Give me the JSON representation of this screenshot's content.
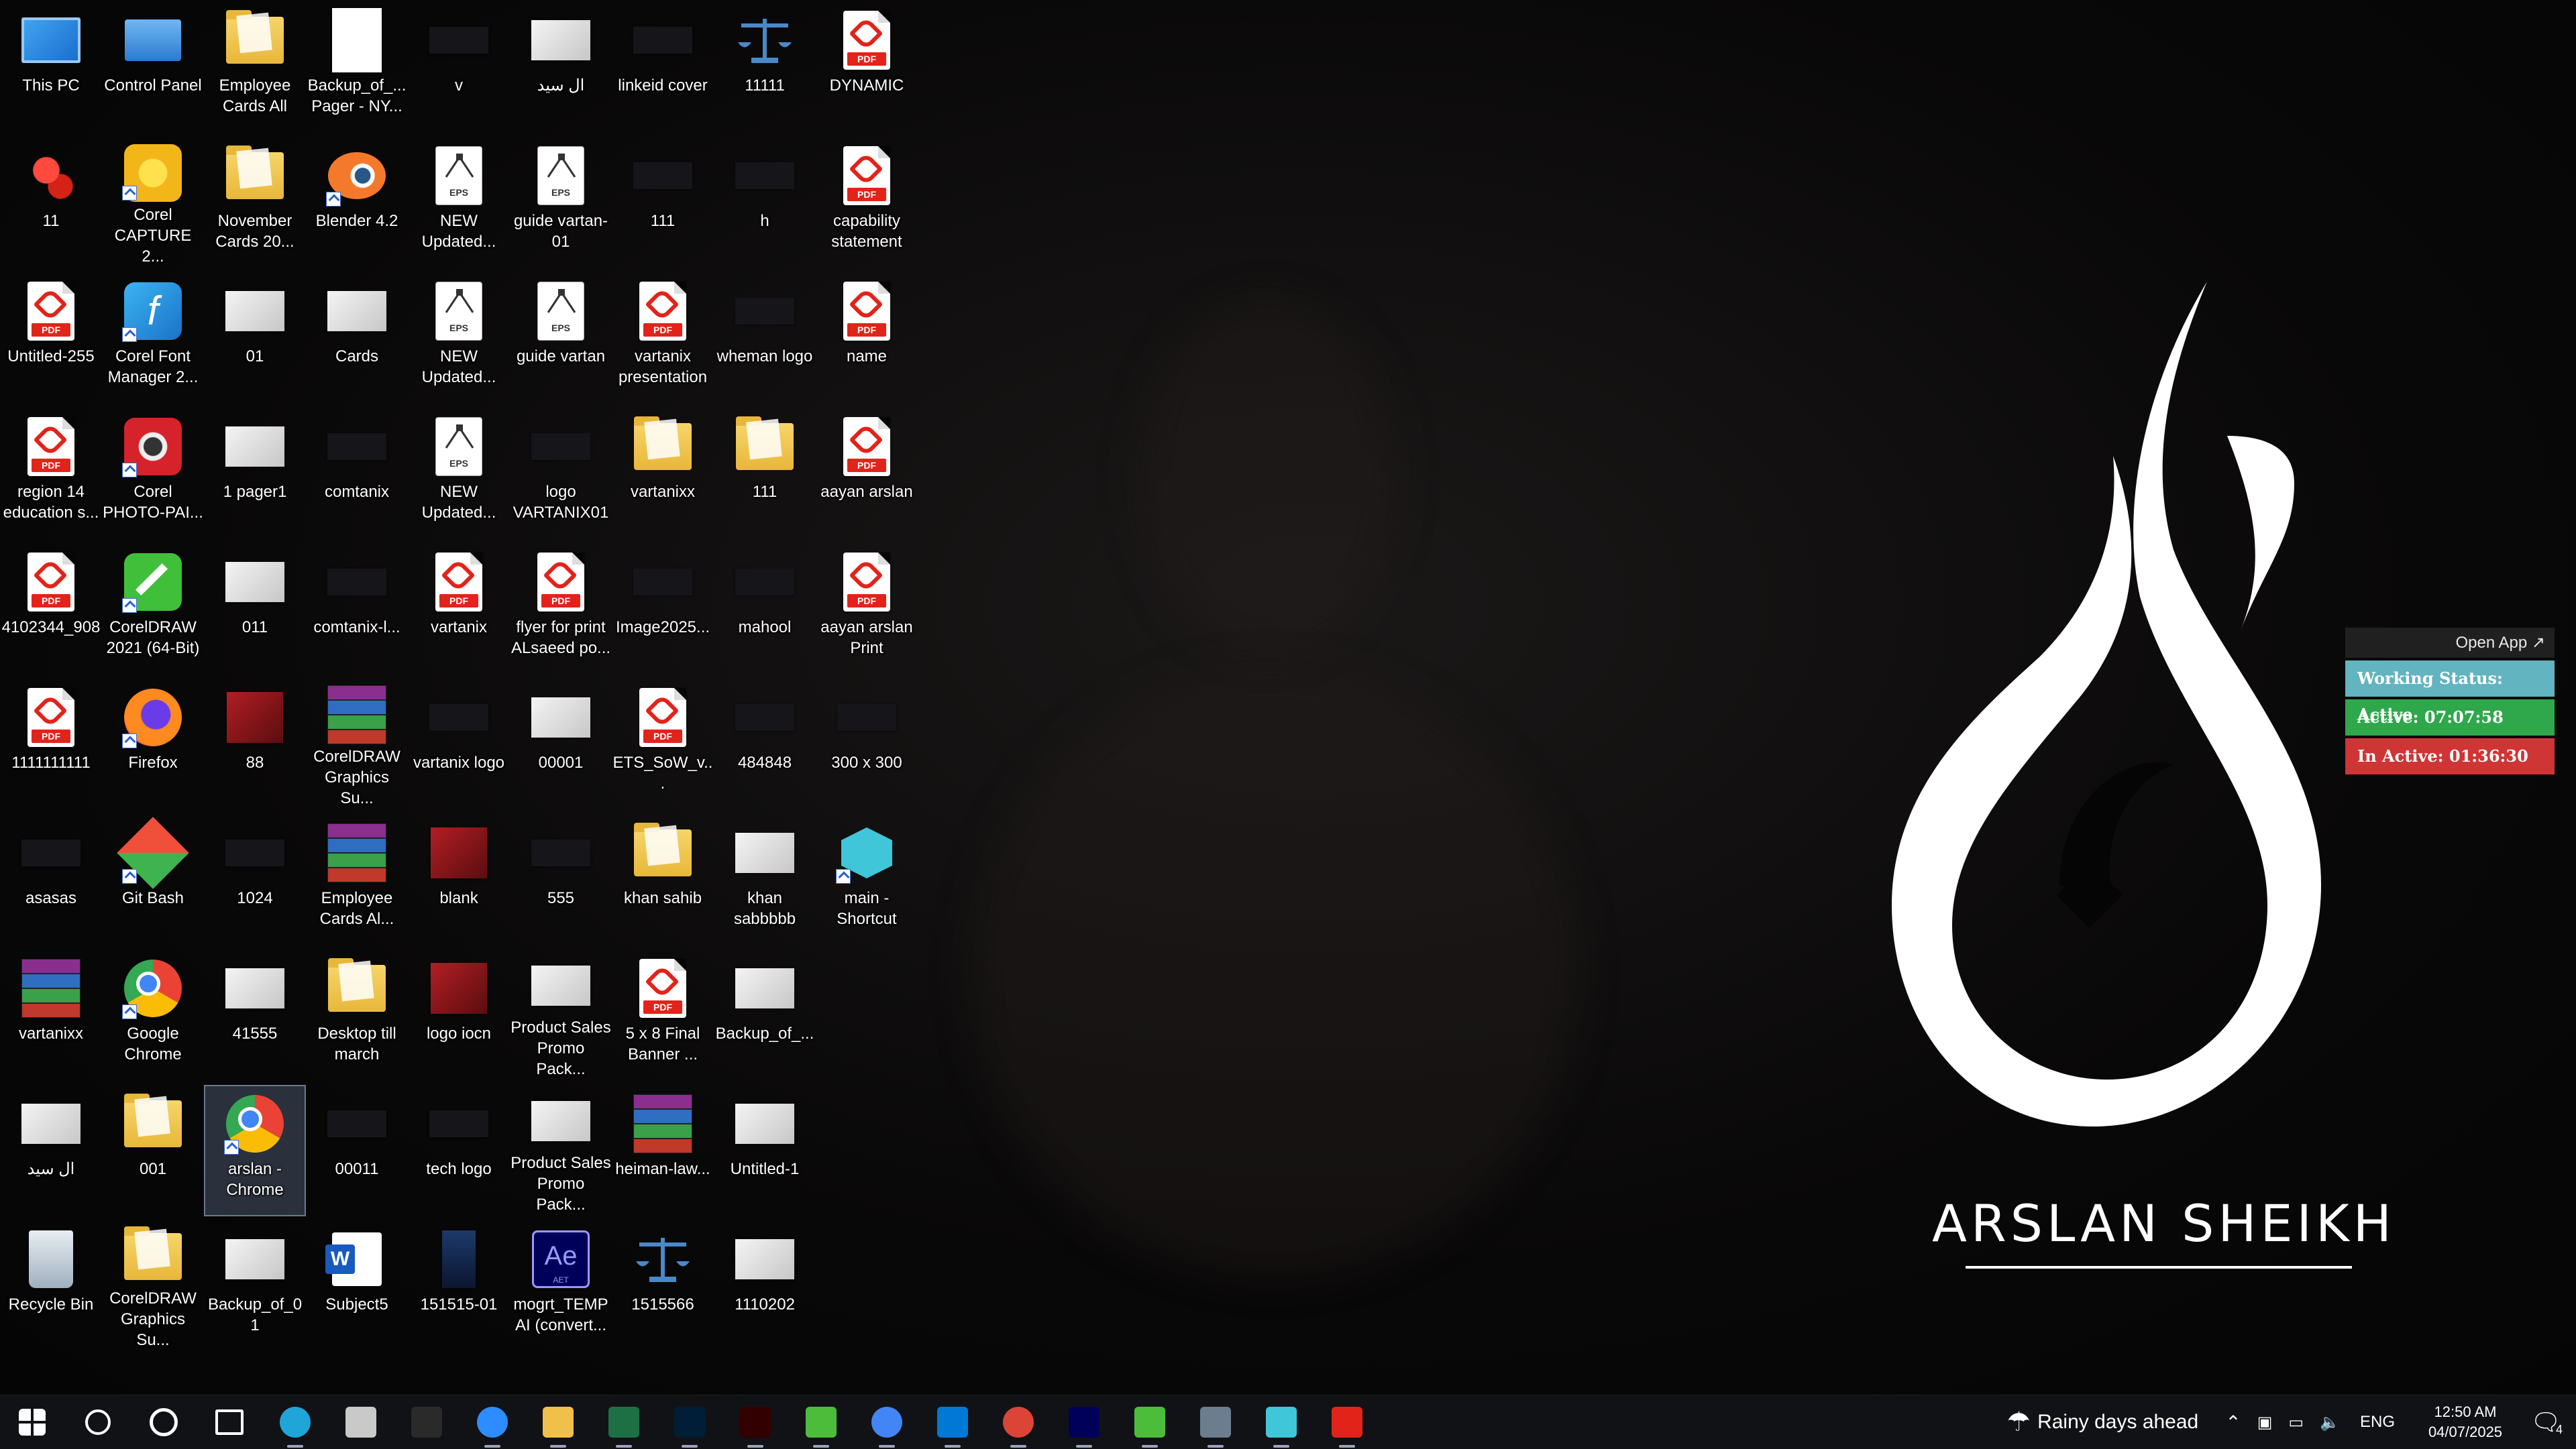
{
  "desktop": {
    "icons": [
      {
        "label": "This PC",
        "type": "pc"
      },
      {
        "label": "Control Panel",
        "type": "cpanel"
      },
      {
        "label": "Employee Cards All",
        "type": "folder"
      },
      {
        "label": "Backup_of_... Pager - NY...",
        "type": "doc"
      },
      {
        "label": "v",
        "type": "thumb-dark"
      },
      {
        "label": "ال سید",
        "type": "thumb"
      },
      {
        "label": "linkeid cover",
        "type": "thumb-dark"
      },
      {
        "label": "11111",
        "type": "scale"
      },
      {
        "label": "DYNAMIC",
        "type": "pdf"
      },
      {
        "label": "11",
        "type": "app-red"
      },
      {
        "label": "Corel CAPTURE 2...",
        "type": "corel-capture"
      },
      {
        "label": "November Cards 20...",
        "type": "folder"
      },
      {
        "label": "Blender 4.2",
        "type": "blender"
      },
      {
        "label": "NEW Updated...",
        "type": "eps"
      },
      {
        "label": "guide vartan-01",
        "type": "eps"
      },
      {
        "label": "111",
        "type": "thumb-dark"
      },
      {
        "label": "h",
        "type": "thumb-dark"
      },
      {
        "label": "capability statement",
        "type": "pdf"
      },
      {
        "label": "Untitled-255",
        "type": "pdf"
      },
      {
        "label": "Corel Font Manager 2...",
        "type": "corel-font"
      },
      {
        "label": "01",
        "type": "thumb"
      },
      {
        "label": "Cards",
        "type": "thumb"
      },
      {
        "label": "NEW Updated...",
        "type": "eps"
      },
      {
        "label": "guide vartan",
        "type": "eps"
      },
      {
        "label": "vartanix presentation",
        "type": "pdf"
      },
      {
        "label": "wheman logo",
        "type": "thumb-dark"
      },
      {
        "label": "name",
        "type": "pdf"
      },
      {
        "label": "region 14 education s...",
        "type": "pdf"
      },
      {
        "label": "Corel PHOTO-PAI...",
        "type": "corel-photo"
      },
      {
        "label": "1 pager1",
        "type": "thumb"
      },
      {
        "label": "comtanix",
        "type": "thumb-dark"
      },
      {
        "label": "NEW Updated...",
        "type": "eps"
      },
      {
        "label": "logo VARTANIX01",
        "type": "thumb-dark"
      },
      {
        "label": "vartanixx",
        "type": "folder"
      },
      {
        "label": "111",
        "type": "folder"
      },
      {
        "label": "aayan arslan",
        "type": "pdf"
      },
      {
        "label": "4102344_908",
        "type": "pdf"
      },
      {
        "label": "CorelDRAW 2021 (64-Bit)",
        "type": "coreldraw"
      },
      {
        "label": "011",
        "type": "thumb"
      },
      {
        "label": "comtanix-l...",
        "type": "thumb-dark"
      },
      {
        "label": "vartanix",
        "type": "pdf"
      },
      {
        "label": "flyer for print ALsaeed po...",
        "type": "pdf"
      },
      {
        "label": "Image2025...",
        "type": "thumb-dark"
      },
      {
        "label": "mahool",
        "type": "thumb-dark"
      },
      {
        "label": "aayan arslan Print",
        "type": "pdf"
      },
      {
        "label": "1111111111",
        "type": "pdf"
      },
      {
        "label": "Firefox",
        "type": "firefox"
      },
      {
        "label": "88",
        "type": "thumb-red"
      },
      {
        "label": "CorelDRAW Graphics Su...",
        "type": "rar"
      },
      {
        "label": "vartanix logo",
        "type": "thumb-dark"
      },
      {
        "label": "00001",
        "type": "thumb"
      },
      {
        "label": "ETS_SoW_v...",
        "type": "pdf"
      },
      {
        "label": "484848",
        "type": "thumb-dark"
      },
      {
        "label": "300 x 300",
        "type": "thumb-dark"
      },
      {
        "label": "asasas",
        "type": "thumb-dark"
      },
      {
        "label": "Git Bash",
        "type": "gitbash"
      },
      {
        "label": "1024",
        "type": "thumb-dark"
      },
      {
        "label": "Employee Cards Al...",
        "type": "rar"
      },
      {
        "label": "blank",
        "type": "thumb-red"
      },
      {
        "label": "555",
        "type": "thumb-dark"
      },
      {
        "label": "khan sahib",
        "type": "folder"
      },
      {
        "label": "khan sabbbbb",
        "type": "thumb"
      },
      {
        "label": "main - Shortcut",
        "type": "mainapp"
      },
      {
        "label": "vartanixx",
        "type": "rar"
      },
      {
        "label": "Google Chrome",
        "type": "chrome"
      },
      {
        "label": "41555",
        "type": "thumb"
      },
      {
        "label": "Desktop till march",
        "type": "folder"
      },
      {
        "label": "logo iocn",
        "type": "thumb-red"
      },
      {
        "label": "Product Sales Promo Pack...",
        "type": "thumb"
      },
      {
        "label": "5 x 8 Final Banner ...",
        "type": "pdf"
      },
      {
        "label": "Backup_of_...",
        "type": "thumb"
      },
      {
        "label": "",
        "type": "none"
      },
      {
        "label": "ال سید",
        "type": "thumb"
      },
      {
        "label": "001",
        "type": "folder"
      },
      {
        "label": "arslan - Chrome",
        "type": "chrome",
        "selected": true
      },
      {
        "label": "00011",
        "type": "thumb-dark"
      },
      {
        "label": "tech logo",
        "type": "thumb-dark"
      },
      {
        "label": "Product Sales Promo Pack...",
        "type": "thumb"
      },
      {
        "label": "heiman-law...",
        "type": "rar"
      },
      {
        "label": "Untitled-1",
        "type": "thumb"
      },
      {
        "label": "",
        "type": "none"
      },
      {
        "label": "Recycle Bin",
        "type": "bin"
      },
      {
        "label": "CorelDRAW Graphics Su...",
        "type": "folder"
      },
      {
        "label": "Backup_of_01",
        "type": "thumb"
      },
      {
        "label": "Subject5",
        "type": "word"
      },
      {
        "label": "151515-01",
        "type": "thumb-blue"
      },
      {
        "label": "mogrt_TEMP AI (convert...",
        "type": "ae"
      },
      {
        "label": "1515566",
        "type": "scale"
      },
      {
        "label": "1110202",
        "type": "thumb"
      },
      {
        "label": "",
        "type": "none"
      }
    ]
  },
  "wallpaper": {
    "name_text": "ARSLAN SHEIKH"
  },
  "status_widget": {
    "open_app": "Open App ↗",
    "working": "Working Status: Active",
    "active": "Active: 07:07:58",
    "inactive": "In Active: 01:36:30",
    "colors": {
      "working": "#62b4c0",
      "active": "#2ea84b",
      "inactive": "#cf3535"
    }
  },
  "taskbar": {
    "items": [
      {
        "name": "start-button",
        "color": "#ffffff"
      },
      {
        "name": "search-button",
        "color": "#ffffff"
      },
      {
        "name": "cortana-button",
        "color": "#ffffff"
      },
      {
        "name": "task-view-button",
        "color": "#ffffff"
      },
      {
        "name": "edge-app",
        "color": "#1fa5d8"
      },
      {
        "name": "pen-app",
        "color": "#c9c9c9"
      },
      {
        "name": "terminal-app",
        "color": "#2a2a2a"
      },
      {
        "name": "zoom-app",
        "color": "#2d8cff"
      },
      {
        "name": "file-explorer-app",
        "color": "#f1c04a"
      },
      {
        "name": "excel-app",
        "color": "#1d7044"
      },
      {
        "name": "photoshop-app",
        "color": "#001e36"
      },
      {
        "name": "illustrator-app",
        "color": "#330000"
      },
      {
        "name": "coreldraw-app",
        "color": "#4cbd3a"
      },
      {
        "name": "chrome-app",
        "color": "#4285f4"
      },
      {
        "name": "vscode-app",
        "color": "#0078d4"
      },
      {
        "name": "chrome-profile-app",
        "color": "#db4437"
      },
      {
        "name": "premiere-app",
        "color": "#00005b"
      },
      {
        "name": "coreldraw-2-app",
        "color": "#4cbd3a"
      },
      {
        "name": "calculator-app",
        "color": "#6b7d8f"
      },
      {
        "name": "main-app",
        "color": "#3fc6d8"
      },
      {
        "name": "acrobat-app",
        "color": "#e2231a"
      }
    ],
    "weather": "Rainy days ahead",
    "language": "ENG",
    "time": "12:50 AM",
    "date": "04/07/2025",
    "notifications": "4"
  }
}
